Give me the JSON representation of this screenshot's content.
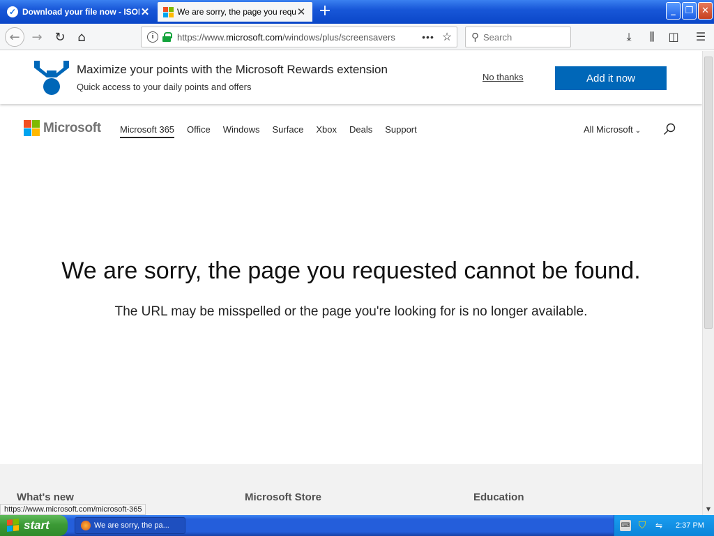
{
  "browser": {
    "tabs": [
      {
        "title": "Download your file now - ISORIVER",
        "active": false
      },
      {
        "title": "We are sorry, the page you requested cannot be found",
        "active": true
      }
    ],
    "url": {
      "prefix": "https://www.",
      "domain": "microsoft.com",
      "path": "/windows/plus/screensavers"
    },
    "search_placeholder": "Search",
    "status_url": "https://www.microsoft.com/microsoft-365"
  },
  "rewards_banner": {
    "headline": "Maximize your points with the Microsoft Rewards extension",
    "subtext": "Quick access to your daily points and offers",
    "dismiss_label": "No thanks",
    "cta_label": "Add it now",
    "cta_color": "#0067b8"
  },
  "site_header": {
    "logo_text": "Microsoft",
    "nav": [
      {
        "label": "Microsoft 365",
        "current": true
      },
      {
        "label": "Office"
      },
      {
        "label": "Windows"
      },
      {
        "label": "Surface"
      },
      {
        "label": "Xbox"
      },
      {
        "label": "Deals"
      },
      {
        "label": "Support"
      }
    ],
    "all_microsoft_label": "All Microsoft"
  },
  "error": {
    "heading": "We are sorry, the page you requested cannot be found.",
    "message": "The URL may be misspelled or the page you're looking for is no longer available."
  },
  "footer": {
    "columns": [
      "What's new",
      "Microsoft Store",
      "Education"
    ]
  },
  "taskbar": {
    "start_label": "start",
    "window_item": "We are sorry, the pa...",
    "clock": "2:37 PM"
  }
}
